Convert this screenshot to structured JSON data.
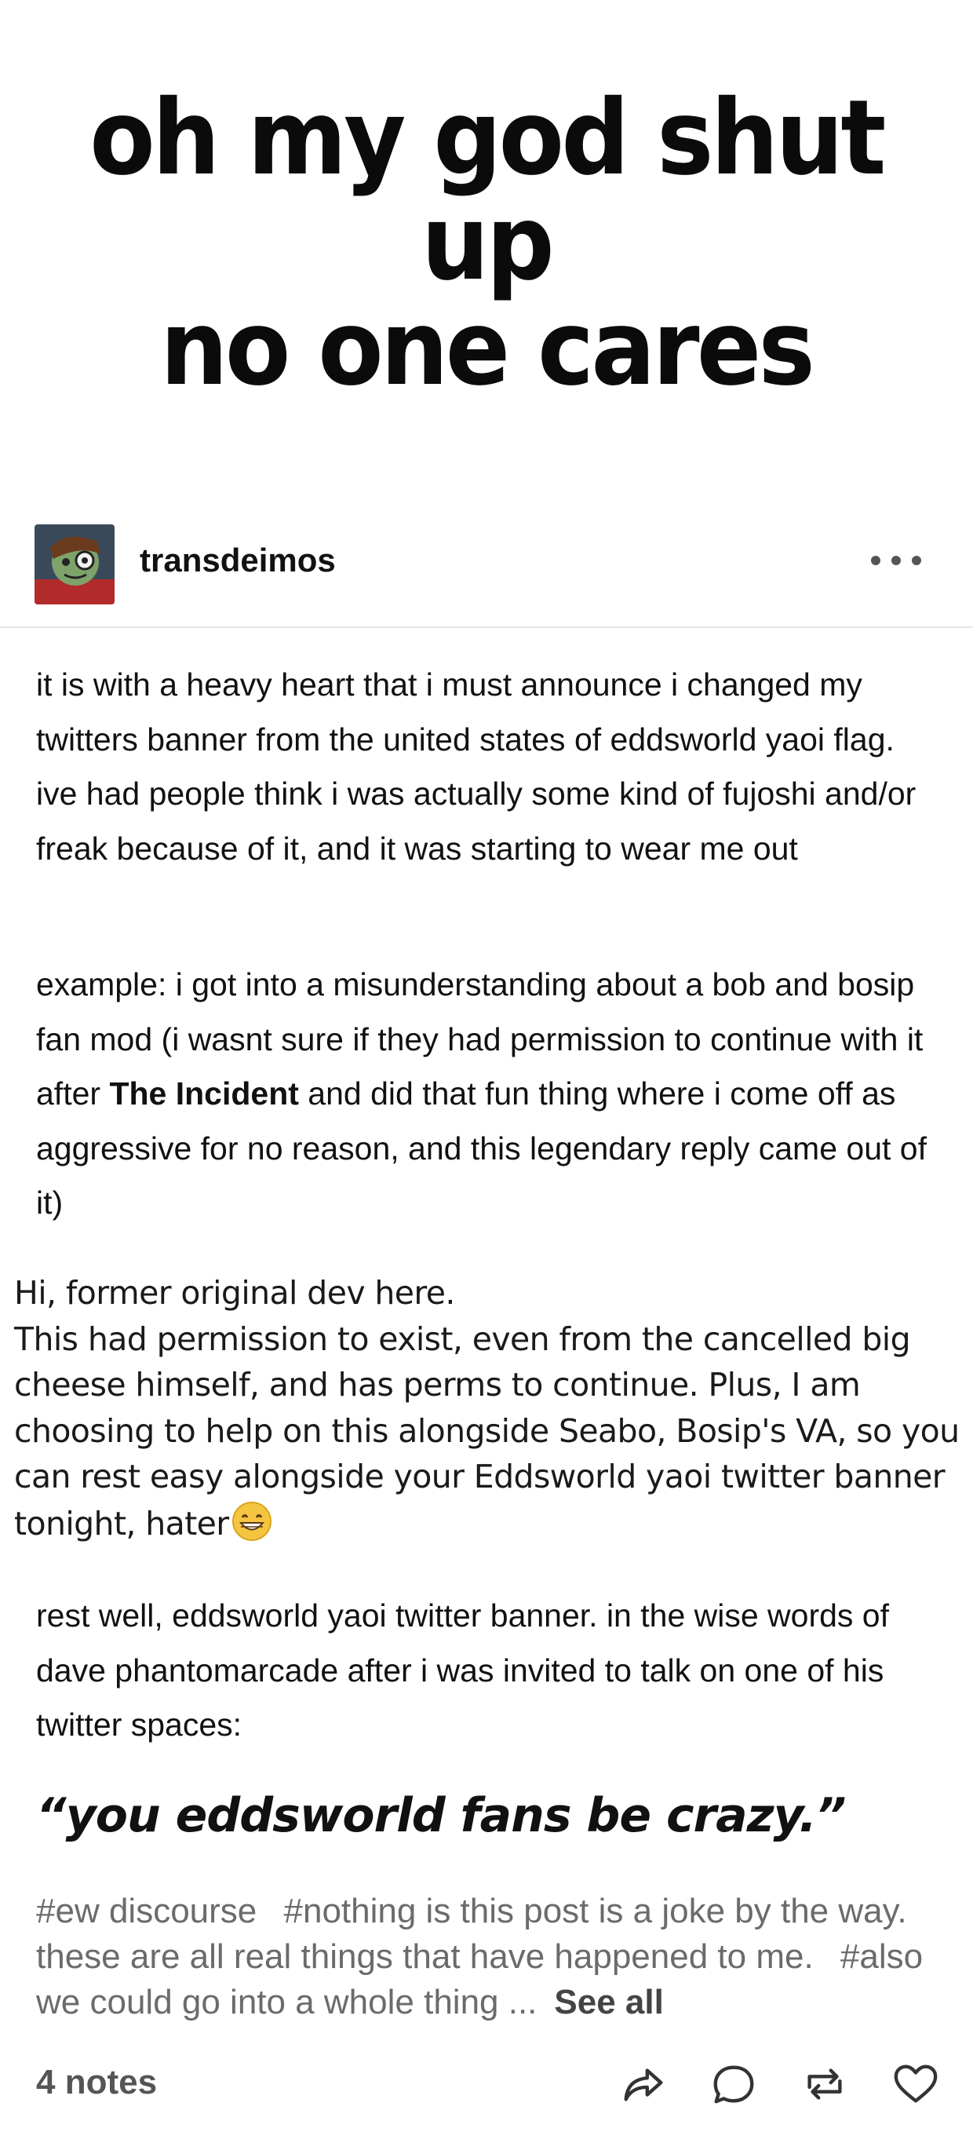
{
  "meme": {
    "line1": "oh my god shut up",
    "line2": "no one cares"
  },
  "post": {
    "username": "transdeimos",
    "paragraph1": "it is with a heavy heart that i must announce i changed my twitters banner from the united states of eddsworld yaoi flag. ive had people think i was actually some kind of fujoshi and/or freak because of it, and it was starting to wear me out",
    "paragraph2_before": "example: i got into a misunderstanding about a bob and bosip fan mod (i wasnt sure if they had permission to continue with it after ",
    "paragraph2_bold": "The Incident",
    "paragraph2_after": " and did that fun thing where i come off as aggressive for no reason, and this legendary reply came out of it)",
    "screenshot": {
      "line1": "Hi, former original dev here.",
      "line2": "This had permission to exist, even from the cancelled big cheese himself, and has perms to continue. Plus, I am choosing to help on this alongside Seabo, Bosip's VA, so you can rest easy alongside your Eddsworld yaoi twitter banner tonight, hater"
    },
    "paragraph3": "rest well, eddsworld yaoi twitter banner. in the wise words of dave phantomarcade after i was invited to talk on one of his twitter spaces:",
    "quote": "“you eddsworld fans be crazy.”",
    "tags": [
      "#ew discourse",
      "#nothing is this post is a joke by the way. these are all real things that have happened to me.",
      "#also we could go into a whole thing ..."
    ],
    "see_all": "See all",
    "notes": "4 notes"
  },
  "icons": {
    "more": "more-options-icon",
    "share": "share-icon",
    "reply": "reply-icon",
    "reblog": "reblog-icon",
    "like": "heart-icon",
    "emoji": "grinning-emoji-icon"
  },
  "colors": {
    "text": "#111111",
    "tags": "#6b6b6b",
    "divider": "#e6e6e6",
    "icon": "#333333"
  }
}
